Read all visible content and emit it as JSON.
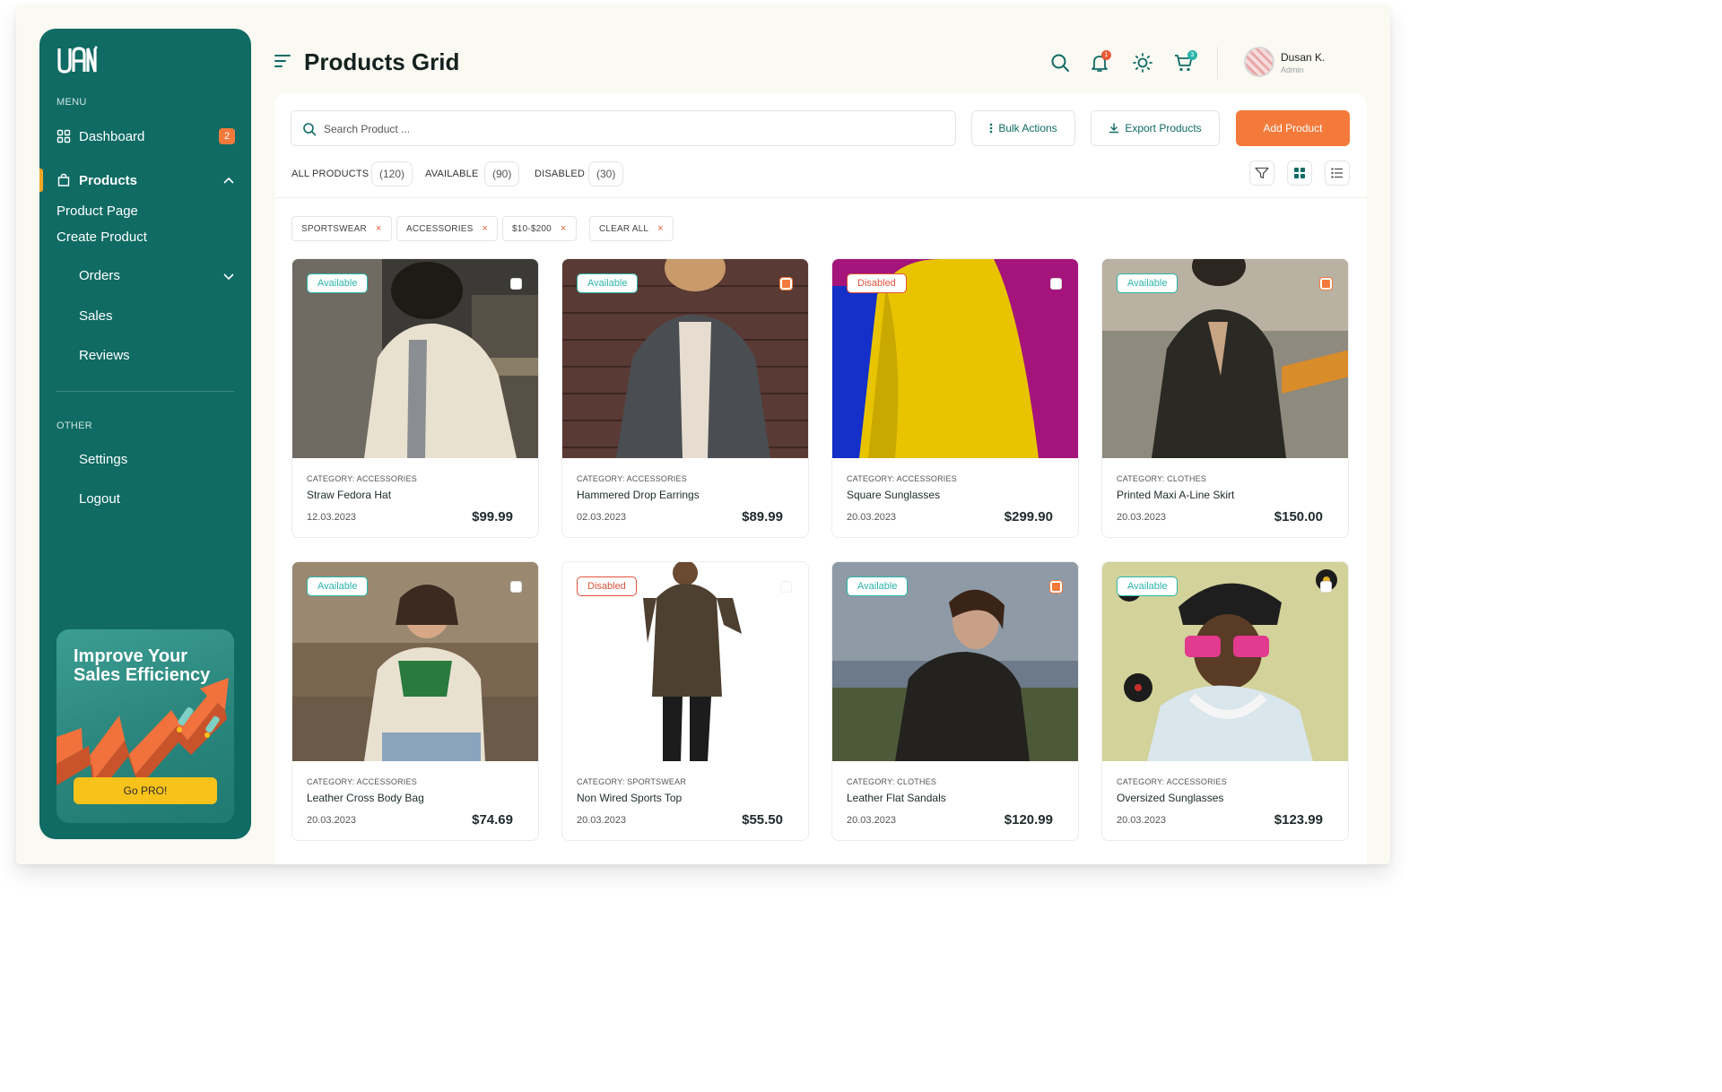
{
  "app": {
    "brand": "UAN"
  },
  "sidebar": {
    "menu_section": "MENU",
    "other_section": "OTHER",
    "dashboard": {
      "label": "Dashboard",
      "badge": "2"
    },
    "products": {
      "label": "Products",
      "sub": [
        "Product Page",
        "Create Product"
      ]
    },
    "orders": {
      "label": "Orders"
    },
    "sales": {
      "label": "Sales"
    },
    "reviews": {
      "label": "Reviews"
    },
    "settings": {
      "label": "Settings"
    },
    "logout": {
      "label": "Logout"
    },
    "promo": {
      "title": "Improve Your Sales Efficiency",
      "button": "Go PRO!"
    }
  },
  "header": {
    "title": "Products Grid",
    "notifications_count": "1",
    "cart_count": "3",
    "user": {
      "name": "Dusan K.",
      "role": "Admin"
    }
  },
  "toolbar": {
    "search_placeholder": "Search Product ...",
    "bulk_actions": "Bulk Actions",
    "export_products": "Export Products",
    "add_product": "Add Product"
  },
  "tabs": [
    {
      "label": "ALL PRODUCTS",
      "count": "(120)"
    },
    {
      "label": "AVAILABLE",
      "count": "(90)"
    },
    {
      "label": "DISABLED",
      "count": "(30)"
    }
  ],
  "filters": [
    "SPORTSWEAR",
    "ACCESSORIES",
    "$10-$200",
    "CLEAR ALL"
  ],
  "colors": {
    "primary": "#0f6b64",
    "accent": "#f47a3b",
    "available": "#2bb5aa",
    "disabled": "#e1513a",
    "promo_button": "#f7c21a"
  },
  "products": [
    {
      "status": "Available",
      "category": "CATEGORY: ACCESSORIES",
      "name": "Straw Fedora Hat",
      "date": "12.03.2023",
      "price": "$99.99"
    },
    {
      "status": "Available",
      "category": "CATEGORY: ACCESSORIES",
      "name": "Hammered Drop Earrings",
      "date": "02.03.2023",
      "price": "$89.99"
    },
    {
      "status": "Disabled",
      "category": "CATEGORY: ACCESSORIES",
      "name": "Square Sunglasses",
      "date": "20.03.2023",
      "price": "$299.90"
    },
    {
      "status": "Available",
      "category": "CATEGORY: CLOTHES",
      "name": "Printed Maxi A-Line Skirt",
      "date": "20.03.2023",
      "price": "$150.00"
    },
    {
      "status": "Available",
      "category": "CATEGORY: ACCESSORIES",
      "name": "Leather Cross Body Bag",
      "date": "20.03.2023",
      "price": "$74.69"
    },
    {
      "status": "Disabled",
      "category": "CATEGORY: SPORTSWEAR",
      "name": "Non Wired Sports Top",
      "date": "20.03.2023",
      "price": "$55.50"
    },
    {
      "status": "Available",
      "category": "CATEGORY: CLOTHES",
      "name": "Leather Flat Sandals",
      "date": "20.03.2023",
      "price": "$120.99"
    },
    {
      "status": "Available",
      "category": "CATEGORY: ACCESSORIES",
      "name": "Oversized Sunglasses",
      "date": "20.03.2023",
      "price": "$123.99"
    }
  ]
}
